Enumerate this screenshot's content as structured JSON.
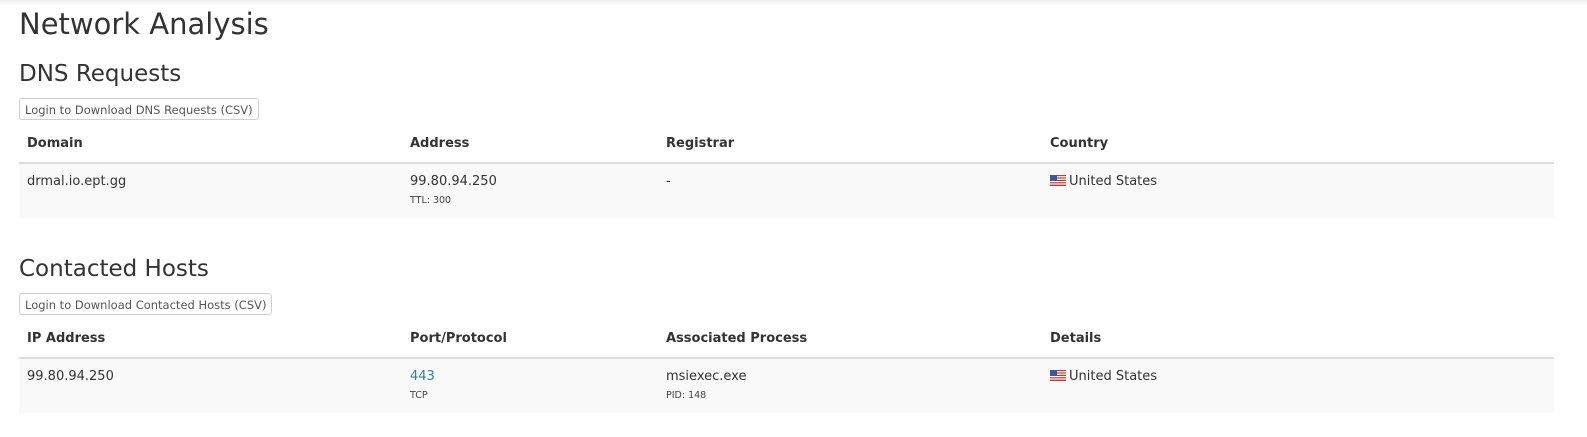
{
  "page_title": "Network Analysis",
  "dns": {
    "heading": "DNS Requests",
    "download_label": "Login to Download DNS Requests (CSV)",
    "columns": [
      "Domain",
      "Address",
      "Registrar",
      "Country"
    ],
    "rows": [
      {
        "domain": "drmal.io.ept.gg",
        "address": "99.80.94.250",
        "ttl": "TTL: 300",
        "registrar": "-",
        "country": "United States",
        "flag_icon": "us-flag-icon"
      }
    ]
  },
  "hosts": {
    "heading": "Contacted Hosts",
    "download_label": "Login to Download Contacted Hosts (CSV)",
    "columns": [
      "IP Address",
      "Port/Protocol",
      "Associated Process",
      "Details"
    ],
    "rows": [
      {
        "ip": "99.80.94.250",
        "port": "443",
        "protocol": "TCP",
        "process": "msiexec.exe",
        "pid": "PID: 148",
        "country": "United States",
        "flag_icon": "us-flag-icon"
      }
    ]
  },
  "colors": {
    "link": "#337ab7",
    "row_bg": "#f9f9f9",
    "border": "#dddddd"
  }
}
